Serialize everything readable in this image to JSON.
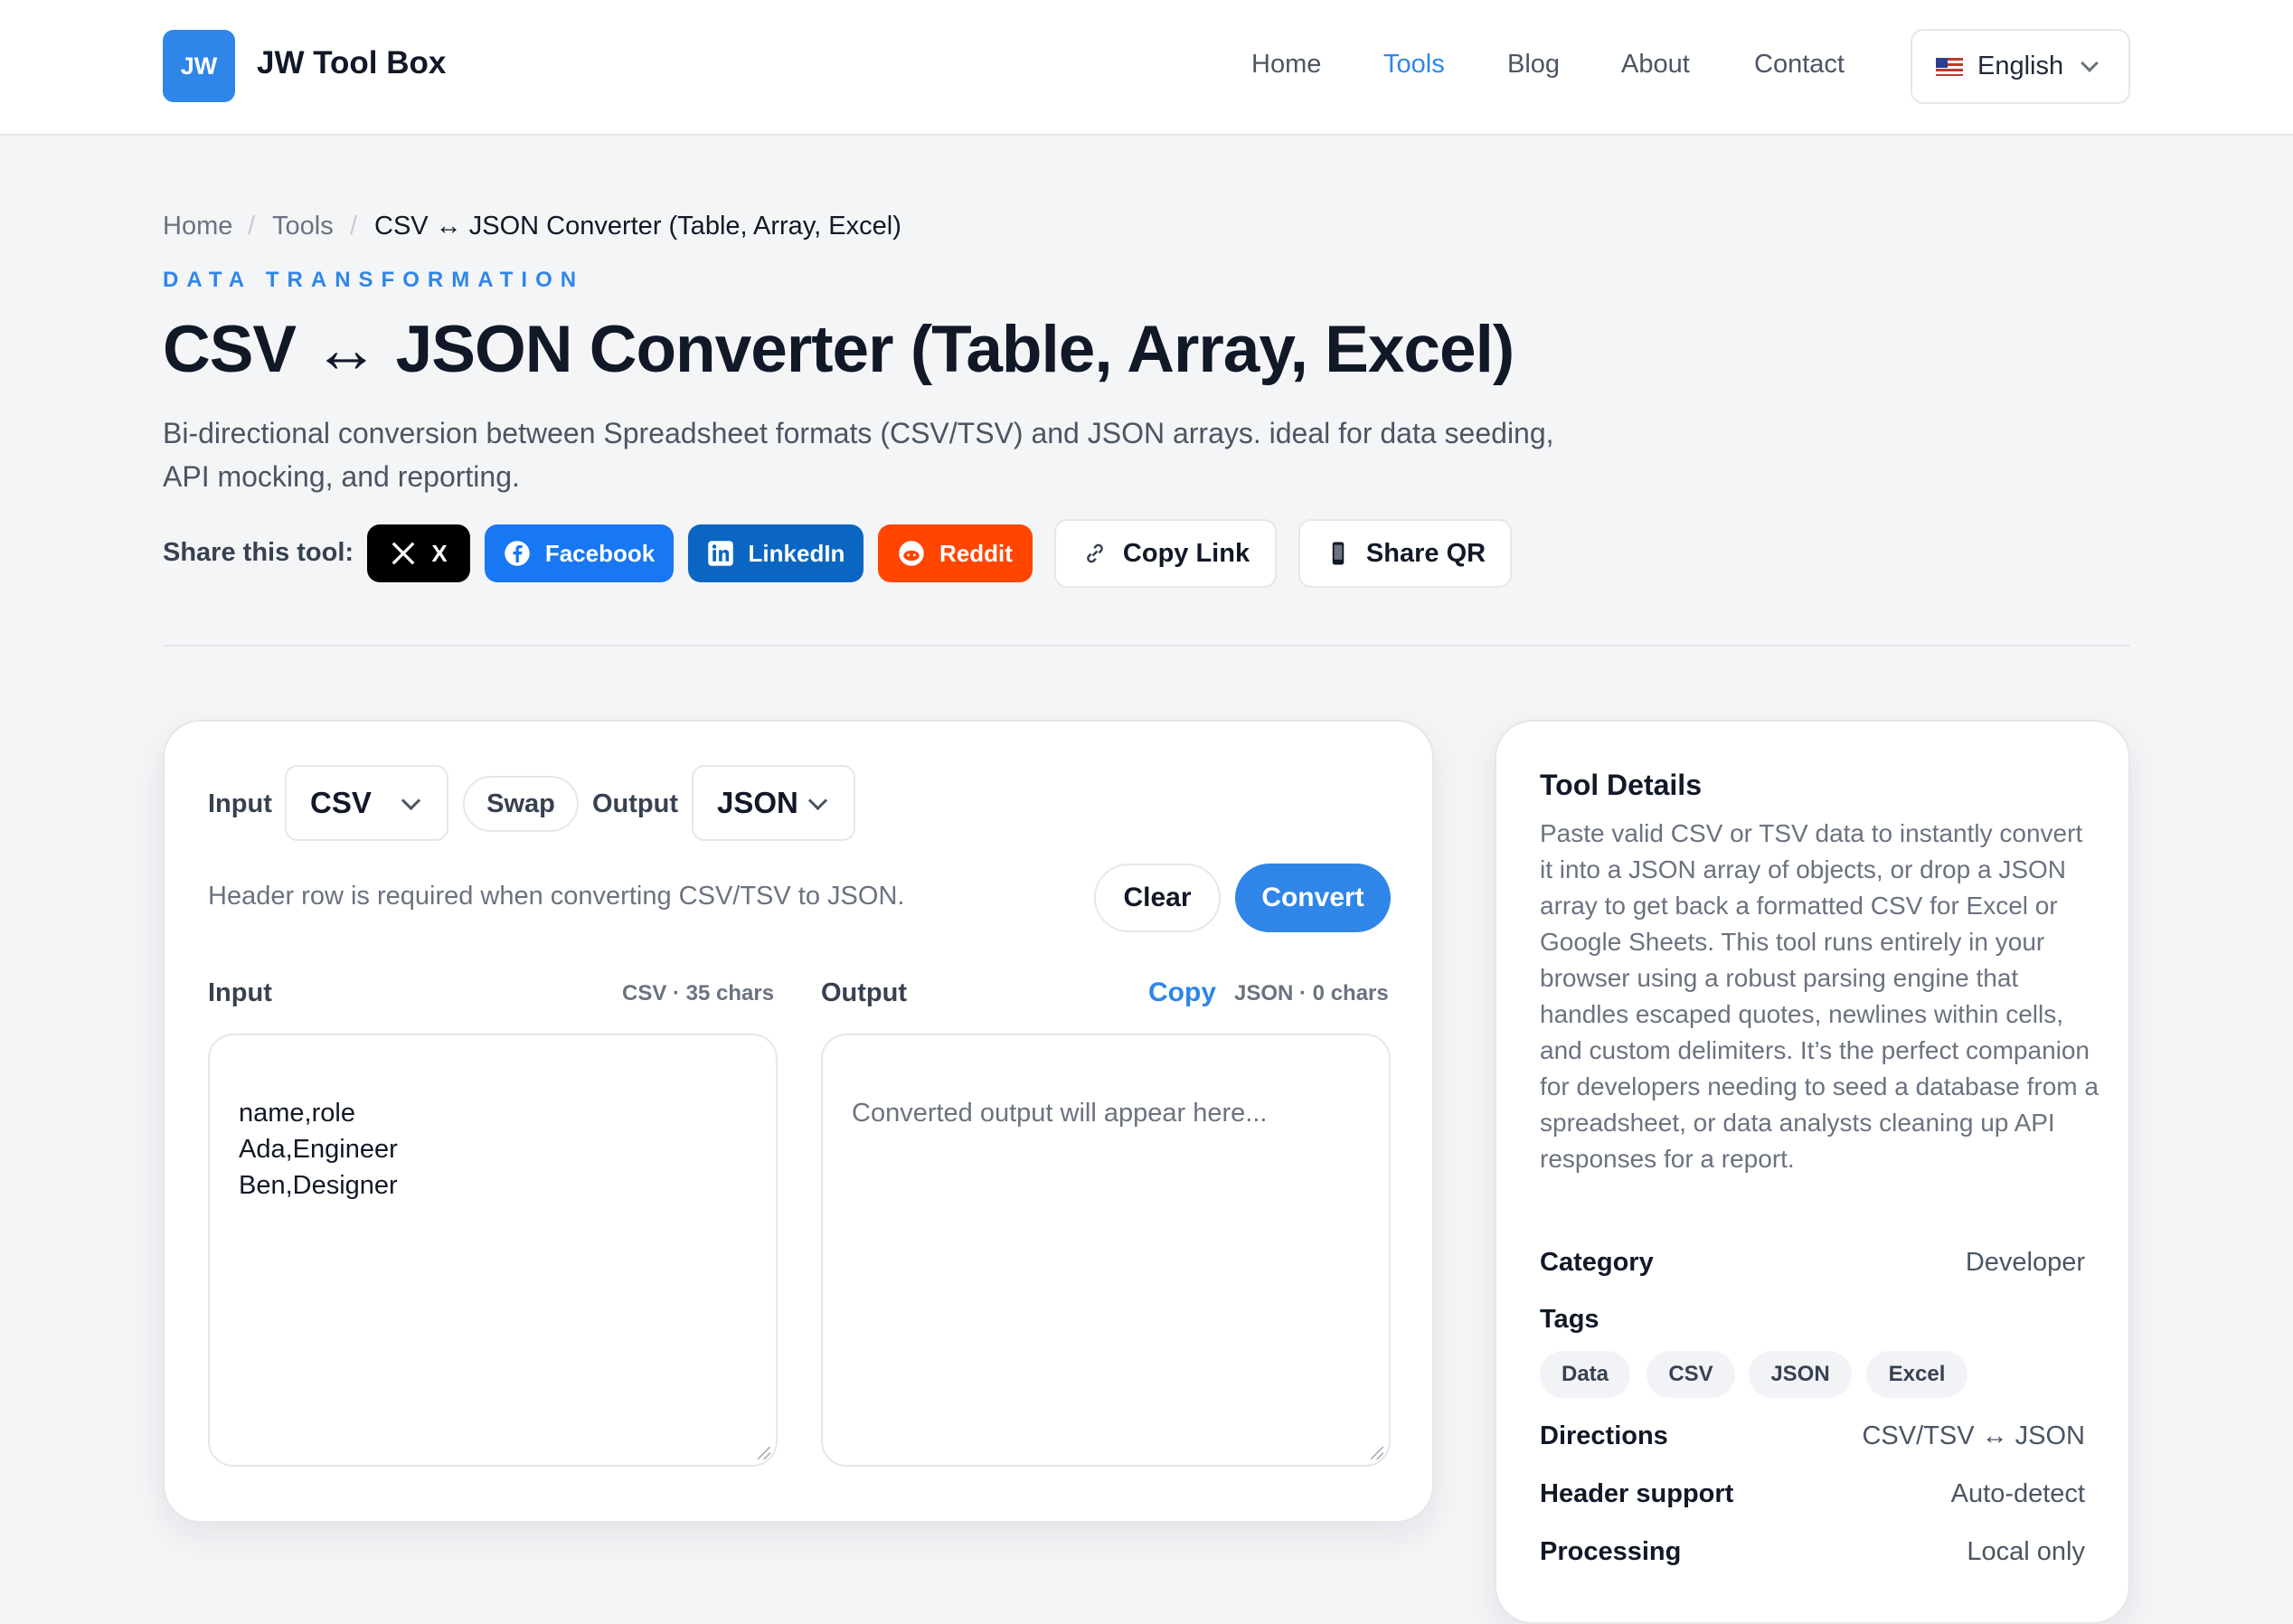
{
  "header": {
    "logo_text": "JW",
    "brand": "JW Tool Box",
    "nav": [
      "Home",
      "Tools",
      "Blog",
      "About",
      "Contact"
    ],
    "active_nav": "Tools",
    "language": "English"
  },
  "breadcrumb": [
    "Home",
    "Tools",
    "CSV ↔ JSON Converter (Table, Array, Excel)"
  ],
  "hero": {
    "eyebrow": "DATA TRANSFORMATION",
    "title": "CSV ↔ JSON Converter (Table, Array, Excel)",
    "description": "Bi-directional conversion between Spreadsheet formats (CSV/TSV) and JSON arrays. ideal for data seeding, API mocking, and reporting."
  },
  "share": {
    "label": "Share this tool:",
    "x": "X",
    "facebook": "Facebook",
    "linkedin": "LinkedIn",
    "reddit": "Reddit",
    "copy_link": "Copy Link",
    "share_qr": "Share QR"
  },
  "converter": {
    "input_label": "Input",
    "input_format": "CSV",
    "swap": "Swap",
    "output_label": "Output",
    "output_format": "JSON",
    "hint": "Header row is required when converting CSV/TSV to JSON.",
    "clear": "Clear",
    "convert": "Convert",
    "input_title": "Input",
    "input_meta": "CSV · 35 chars",
    "output_title": "Output",
    "copy": "Copy",
    "output_meta": "JSON · 0 chars",
    "input_value": "name,role\nAda,Engineer\nBen,Designer",
    "output_placeholder": "Converted output will appear here..."
  },
  "details": {
    "title": "Tool Details",
    "description": "Paste valid CSV or TSV data to instantly convert it into a JSON array of objects, or drop a JSON array to get back a formatted CSV for Excel or Google Sheets. This tool runs entirely in your browser using a robust parsing engine that handles escaped quotes, newlines within cells, and custom delimiters. It’s the perfect companion for developers needing to seed a database from a spreadsheet, or data analysts cleaning up API responses for a report.",
    "category_label": "Category",
    "category_value": "Developer",
    "tags_label": "Tags",
    "tags": [
      "Data",
      "CSV",
      "JSON",
      "Excel"
    ],
    "directions_label": "Directions",
    "directions_value": "CSV/TSV ↔ JSON",
    "header_label": "Header support",
    "header_value": "Auto-detect",
    "processing_label": "Processing",
    "processing_value": "Local only"
  },
  "colors": {
    "accent": "#2f86e8",
    "x": "#000000",
    "facebook": "#1877f2",
    "linkedin": "#0a66c2",
    "reddit": "#ff4500"
  }
}
